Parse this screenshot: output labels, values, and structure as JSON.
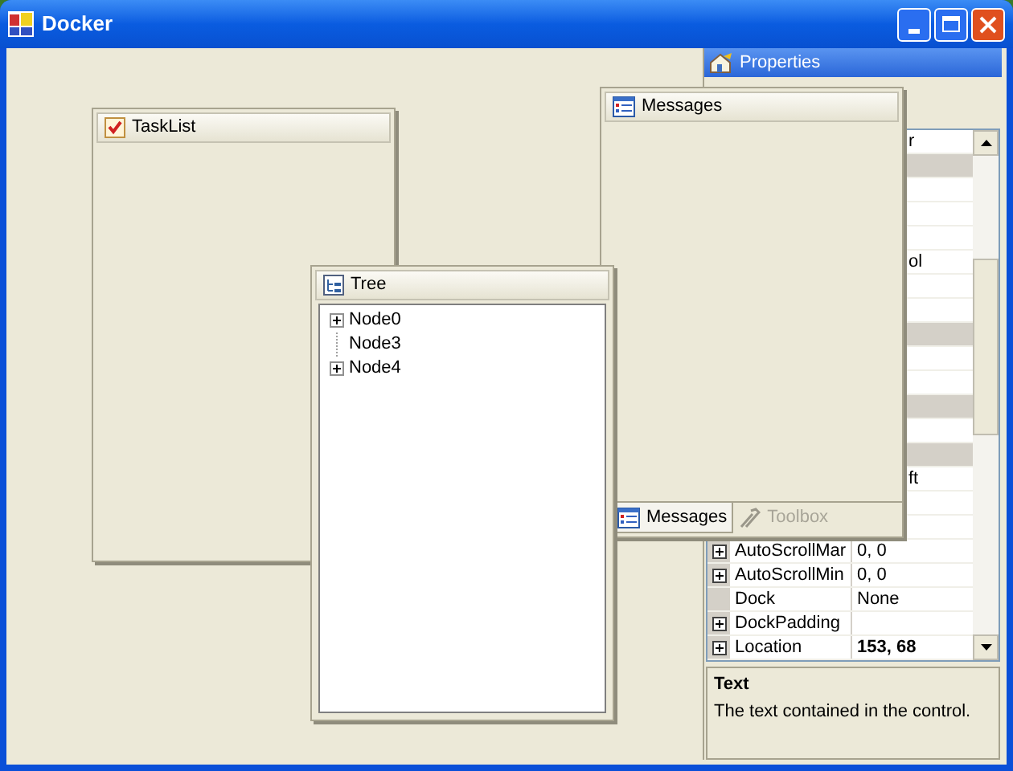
{
  "window": {
    "title": "Docker"
  },
  "properties": {
    "title": "Properties",
    "rows": [
      {
        "kind": "covered",
        "value": "r"
      },
      {
        "kind": "category"
      },
      {
        "kind": "blank"
      },
      {
        "kind": "blank"
      },
      {
        "kind": "blank"
      },
      {
        "kind": "covered",
        "value": "ol"
      },
      {
        "kind": "blank"
      },
      {
        "kind": "blank"
      },
      {
        "kind": "category"
      },
      {
        "kind": "blank"
      },
      {
        "kind": "blank"
      },
      {
        "kind": "category"
      },
      {
        "kind": "blank"
      },
      {
        "kind": "category"
      },
      {
        "kind": "covered",
        "value": "ft"
      },
      {
        "kind": "blank"
      },
      {
        "kind": "blank"
      },
      {
        "kind": "property",
        "name": "AutoScrollMar",
        "value": "0, 0",
        "expandable": true,
        "modified": false
      },
      {
        "kind": "property",
        "name": "AutoScrollMin",
        "value": "0, 0",
        "expandable": true,
        "modified": false
      },
      {
        "kind": "property",
        "name": "Dock",
        "value": "None",
        "expandable": false,
        "modified": false
      },
      {
        "kind": "property",
        "name": "DockPadding",
        "expandable": true
      },
      {
        "kind": "property",
        "name": "Location",
        "value": "153, 68",
        "expandable": true,
        "modified": true
      }
    ],
    "description": {
      "title": "Text",
      "text": "The text contained in the control."
    }
  },
  "tasklist": {
    "title": "TaskList"
  },
  "tree": {
    "title": "Tree",
    "nodes": [
      {
        "label": "Node0",
        "kind": "branch"
      },
      {
        "label": "Node3",
        "kind": "leaf"
      },
      {
        "label": "Node4",
        "kind": "branch"
      }
    ]
  },
  "messages": {
    "title": "Messages",
    "tabs": [
      {
        "label": "Messages",
        "kind": "messages",
        "selected": true
      },
      {
        "label": "Toolbox",
        "kind": "toolbox",
        "selected": false
      }
    ]
  }
}
